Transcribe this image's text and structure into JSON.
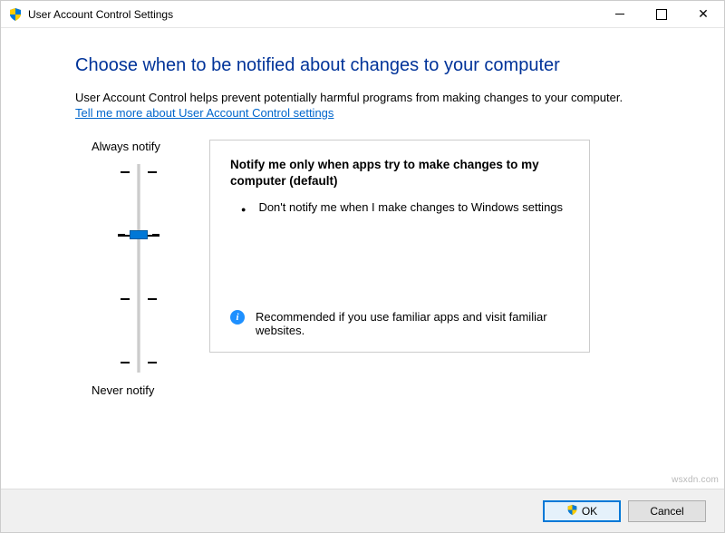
{
  "window": {
    "title": "User Account Control Settings"
  },
  "main": {
    "heading": "Choose when to be notified about changes to your computer",
    "description": "User Account Control helps prevent potentially harmful programs from making changes to your computer.",
    "link": "Tell me more about User Account Control settings"
  },
  "slider": {
    "top_label": "Always notify",
    "bottom_label": "Never notify",
    "levels": 4,
    "current_level": 2
  },
  "panel": {
    "title": "Notify me only when apps try to make changes to my computer (default)",
    "bullet": "Don't notify me when I make changes to Windows settings",
    "recommendation": "Recommended if you use familiar apps and visit familiar websites."
  },
  "buttons": {
    "ok": "OK",
    "cancel": "Cancel"
  },
  "watermark": "wsxdn.com"
}
